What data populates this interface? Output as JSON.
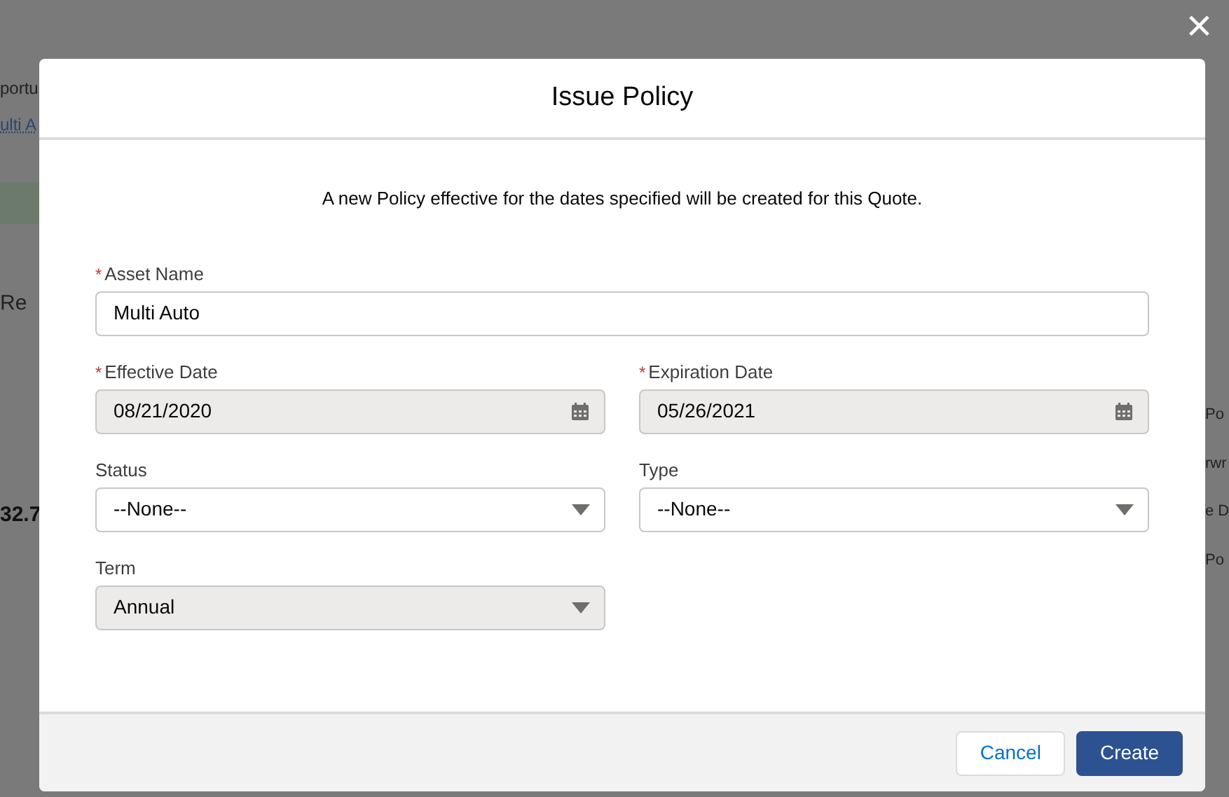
{
  "background": {
    "left": [
      {
        "kind": "plain",
        "text": "portu"
      },
      {
        "kind": "link",
        "text": "ulti A"
      },
      {
        "kind": "band"
      },
      {
        "kind": "plain",
        "text": "Re"
      },
      {
        "kind": "bold",
        "text": "32.7"
      }
    ],
    "right": [
      "Po",
      "rwr",
      "e D",
      "Po"
    ]
  },
  "close_button": "×",
  "modal": {
    "title": "Issue Policy",
    "message": "A new Policy effective for the dates specified will be created for this Quote.",
    "fields": [
      {
        "label": "Asset Name",
        "required": true,
        "kind": "text",
        "value": "Multi Auto",
        "disabled": false
      },
      {
        "label": "Effective Date",
        "required": true,
        "kind": "date",
        "value": "08/21/2020",
        "disabled": true
      },
      {
        "label": "Expiration Date",
        "required": true,
        "kind": "date",
        "value": "05/26/2021",
        "disabled": true
      },
      {
        "label": "Status",
        "required": false,
        "kind": "select",
        "value": "--None--",
        "disabled": false
      },
      {
        "label": "Type",
        "required": false,
        "kind": "select",
        "value": "--None--",
        "disabled": false
      },
      {
        "label": "Term",
        "required": false,
        "kind": "select",
        "value": "Annual",
        "disabled": true
      }
    ],
    "required_mark": "*",
    "buttons": [
      {
        "label": "Cancel",
        "kind": "neutral"
      },
      {
        "label": "Create",
        "kind": "brand"
      }
    ]
  }
}
